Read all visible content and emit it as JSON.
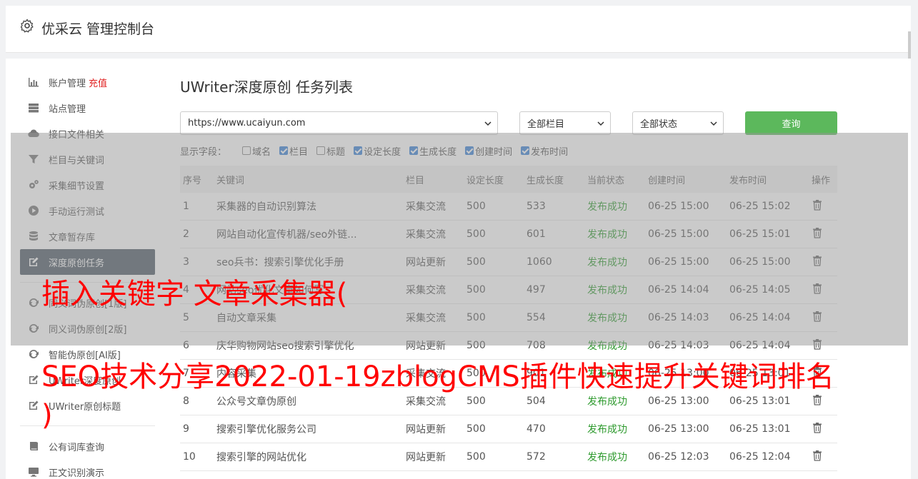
{
  "header": {
    "title": "优采云 管理控制台",
    "icon": "gear-icon"
  },
  "sidebar": {
    "items": [
      {
        "label": "账户管理",
        "extra": "充值",
        "icon": "bar-chart-icon"
      },
      {
        "label": "站点管理",
        "icon": "server-icon"
      },
      {
        "label": "接口文件相关",
        "icon": "cloud-upload-icon"
      },
      {
        "label": "栏目与关键词",
        "icon": "filter-icon"
      },
      {
        "label": "采集细节设置",
        "icon": "cogs-icon"
      },
      {
        "label": "手动运行测试",
        "icon": "play-circle-icon"
      },
      {
        "label": "文章暂存库",
        "icon": "database-icon"
      },
      {
        "label": "深度原创任务",
        "icon": "edit-icon",
        "active": true
      },
      {
        "label": "同义词伪原创[1版]",
        "icon": "refresh-icon"
      },
      {
        "label": "同义词伪原创[2版]",
        "icon": "refresh-icon"
      },
      {
        "label": "智能伪原创[AI版]",
        "icon": "refresh-icon"
      },
      {
        "label": "UWriter深度原创",
        "icon": "edit-icon"
      },
      {
        "label": "UWriter原创标题",
        "icon": "edit-icon"
      },
      {
        "label": "公有词库查询",
        "icon": "book-icon"
      },
      {
        "label": "正文识别演示",
        "icon": "monitor-icon"
      }
    ]
  },
  "main": {
    "title": "UWriter深度原创 任务列表",
    "site_select": "https://www.ucaiyun.com",
    "column_select": "全部栏目",
    "status_select": "全部状态",
    "query_button": "查询",
    "fields_label": "显示字段：",
    "fields": [
      {
        "label": "域名",
        "checked": false
      },
      {
        "label": "栏目",
        "checked": true
      },
      {
        "label": "标题",
        "checked": false
      },
      {
        "label": "设定长度",
        "checked": true
      },
      {
        "label": "生成长度",
        "checked": true
      },
      {
        "label": "创建时间",
        "checked": true
      },
      {
        "label": "发布时间",
        "checked": true
      }
    ]
  },
  "table": {
    "headers": [
      "序号",
      "关键词",
      "栏目",
      "设定长度",
      "生成长度",
      "当前状态",
      "创建时间",
      "发布时间",
      "操作"
    ],
    "rows": [
      {
        "no": "1",
        "kw": "采集器的自动识别算法",
        "col": "采集交流",
        "len": "500",
        "gen": "533",
        "st": "发布成功",
        "ct": "06-25 15:00",
        "pt": "06-25 15:02"
      },
      {
        "no": "2",
        "kw": "网站自动化宣传机器/seo外链...",
        "col": "采集交流",
        "len": "500",
        "gen": "601",
        "st": "发布成功",
        "ct": "06-25 15:00",
        "pt": "06-25 15:01"
      },
      {
        "no": "3",
        "kw": "seo兵书：搜索引擎优化手册",
        "col": "网站更新",
        "len": "500",
        "gen": "1060",
        "st": "发布成功",
        "ct": "06-25 15:00",
        "pt": "06-25 15:00"
      },
      {
        "no": "4",
        "kw": "网站seo优化文章如何写",
        "col": "采集交流",
        "len": "500",
        "gen": "497",
        "st": "发布成功",
        "ct": "06-25 14:04",
        "pt": "06-25 14:05"
      },
      {
        "no": "5",
        "kw": "自动文章采集",
        "col": "采集交流",
        "len": "500",
        "gen": "554",
        "st": "发布成功",
        "ct": "06-25 14:03",
        "pt": "06-25 14:04"
      },
      {
        "no": "6",
        "kw": "庆华购物网站seo搜索引擎优化",
        "col": "网站更新",
        "len": "500",
        "gen": "708",
        "st": "发布成功",
        "ct": "06-25 14:03",
        "pt": "06-25 14:04"
      },
      {
        "no": "7",
        "kw": "内容采集",
        "col": "采集交流",
        "len": "500",
        "gen": "901",
        "st": "发布成功",
        "ct": "06-25 13:00",
        "pt": "06-25 13:01"
      },
      {
        "no": "8",
        "kw": "公众号文章伪原创",
        "col": "采集交流",
        "len": "500",
        "gen": "504",
        "st": "发布成功",
        "ct": "06-25 13:00",
        "pt": "06-25 13:01"
      },
      {
        "no": "9",
        "kw": "搜索引擎优化服务公司",
        "col": "网站更新",
        "len": "500",
        "gen": "470",
        "st": "发布成功",
        "ct": "06-25 13:00",
        "pt": "06-25 13:01"
      },
      {
        "no": "10",
        "kw": "搜索引擎的网站优化",
        "col": "网站更新",
        "len": "500",
        "gen": "572",
        "st": "发布成功",
        "ct": "06-25 12:03",
        "pt": "06-25 12:04"
      }
    ]
  },
  "overlay": {
    "line1": "插入关键字 文章采集器(",
    "line2": "SEO技术分享2022-01-19zblogCMS插件快速提升关键词排名",
    "line3": ")"
  }
}
